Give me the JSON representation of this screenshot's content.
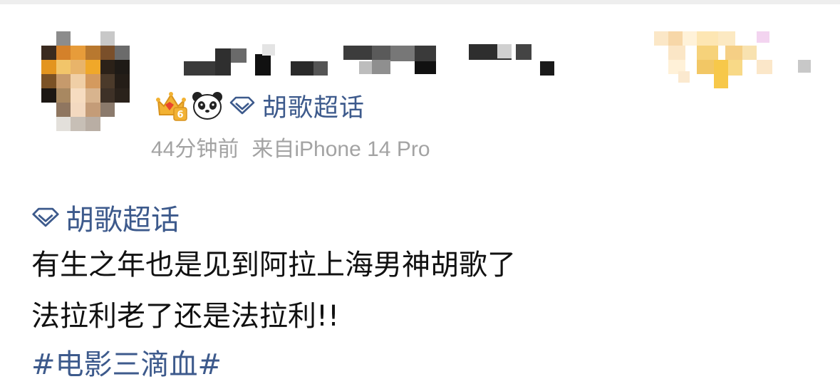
{
  "post": {
    "header": {
      "avatar": {
        "icon": "avatar-image",
        "pixelated": true
      },
      "username": {
        "pixelated": true
      },
      "member_badges": {
        "pixelated": true
      },
      "badges": [
        {
          "name": "crown-level-icon",
          "level": "6"
        },
        {
          "name": "panda-icon"
        }
      ],
      "supertopic": {
        "icon": "supertopic-diamond-icon",
        "label": "胡歌超话"
      }
    },
    "meta": {
      "time": "44分钟前",
      "source": "来自iPhone 14 Pro"
    },
    "content": {
      "topic": {
        "icon": "supertopic-diamond-icon",
        "label": "胡歌超话"
      },
      "lines": [
        "有生之年也是见到阿拉上海男神胡歌了",
        "法拉利老了还是法拉利!!"
      ],
      "hashtag": "#电影三滴血#"
    }
  },
  "colors": {
    "link": "#3d5a8c",
    "meta": "#a3a3a3",
    "text": "#111111",
    "background": "#ffffff"
  }
}
